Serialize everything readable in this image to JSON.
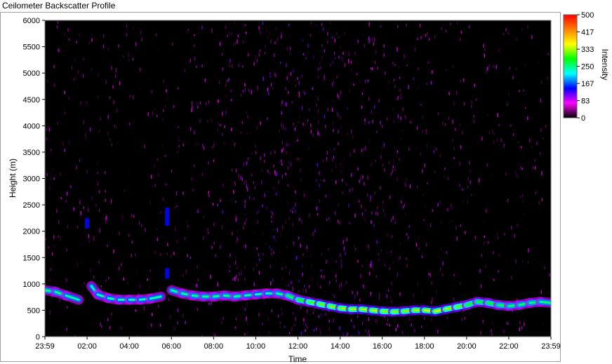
{
  "window": {
    "title": "Ceilometer Backscatter Profile"
  },
  "colors": {
    "plot_background": "#000000",
    "noise_hue": "#cc00cc",
    "colorbar": [
      "#000000",
      "#ff00ff",
      "#0000ff",
      "#00ffff",
      "#00ff00",
      "#ffff00",
      "#ff8000",
      "#ff0000"
    ]
  },
  "chart_data": {
    "type": "heatmap",
    "title": "Ceilometer Backscatter Profile",
    "xlabel": "Time",
    "ylabel": "Height (m)",
    "colorbar_label": "Intensity",
    "x_tick_labels": [
      "23:59",
      "02:00",
      "04:00",
      "06:00",
      "08:00",
      "10:00",
      "12:00",
      "14:00",
      "16:00",
      "18:00",
      "20:00",
      "22:00",
      "23:59"
    ],
    "x_ticks_hours": [
      0,
      2,
      4,
      6,
      8,
      10,
      12,
      14,
      16,
      18,
      20,
      22,
      24
    ],
    "xlim_hours": [
      0,
      24
    ],
    "y_tick_labels": [
      "0",
      "500",
      "1000",
      "1500",
      "2000",
      "2500",
      "3000",
      "3500",
      "4000",
      "4500",
      "5000",
      "5500",
      "6000"
    ],
    "y_ticks": [
      0,
      500,
      1000,
      1500,
      2000,
      2500,
      3000,
      3500,
      4000,
      4500,
      5000,
      5500,
      6000
    ],
    "ylim": [
      0,
      6000
    ],
    "colorbar_tick_labels": [
      "500",
      "417",
      "333",
      "250",
      "167",
      "83",
      "0"
    ],
    "colorbar_ticks": [
      500,
      417,
      333,
      250,
      167,
      83,
      0
    ],
    "colorbar_range": [
      0,
      500
    ],
    "cloud_layer": {
      "description_hours": [
        0.0,
        0.5,
        1.0,
        1.6,
        2.0,
        2.2,
        2.5,
        3.0,
        3.5,
        4.0,
        4.5,
        5.0,
        5.5,
        5.9,
        6.0,
        6.5,
        7.0,
        7.5,
        8.0,
        8.5,
        9.0,
        9.5,
        10.0,
        10.5,
        11.0,
        11.5,
        12.0,
        12.5,
        13.0,
        13.5,
        14.0,
        14.5,
        15.0,
        15.5,
        16.0,
        16.5,
        17.0,
        17.5,
        18.0,
        18.5,
        19.0,
        19.5,
        20.0,
        20.5,
        21.0,
        21.5,
        22.0,
        22.5,
        23.0,
        23.5,
        24.0
      ],
      "height_m": [
        880,
        850,
        780,
        700,
        null,
        960,
        800,
        730,
        700,
        700,
        700,
        720,
        760,
        null,
        880,
        820,
        780,
        760,
        760,
        780,
        760,
        780,
        800,
        820,
        820,
        780,
        700,
        660,
        620,
        580,
        540,
        520,
        520,
        500,
        480,
        470,
        480,
        500,
        500,
        480,
        520,
        560,
        600,
        660,
        640,
        600,
        580,
        600,
        640,
        660,
        640
      ],
      "intensity": [
        250,
        260,
        250,
        240,
        null,
        240,
        240,
        240,
        240,
        240,
        240,
        240,
        240,
        null,
        250,
        250,
        250,
        250,
        250,
        250,
        250,
        250,
        240,
        240,
        240,
        260,
        280,
        300,
        310,
        320,
        330,
        330,
        340,
        340,
        330,
        320,
        320,
        330,
        340,
        350,
        340,
        320,
        300,
        280,
        280,
        280,
        260,
        260,
        260,
        260,
        250
      ]
    },
    "elevated_features": [
      {
        "hour": 2.0,
        "height_range_m": [
          2050,
          2250
        ],
        "intensity": 90
      },
      {
        "hour": 5.8,
        "height_range_m": [
          2100,
          2450
        ],
        "intensity": 90
      },
      {
        "hour": 5.8,
        "height_range_m": [
          1100,
          1300
        ],
        "intensity": 90
      }
    ],
    "background_noise": {
      "intensity_range": [
        0,
        120
      ],
      "max_height_m": 6000,
      "peak_hour": 12.5
    }
  }
}
